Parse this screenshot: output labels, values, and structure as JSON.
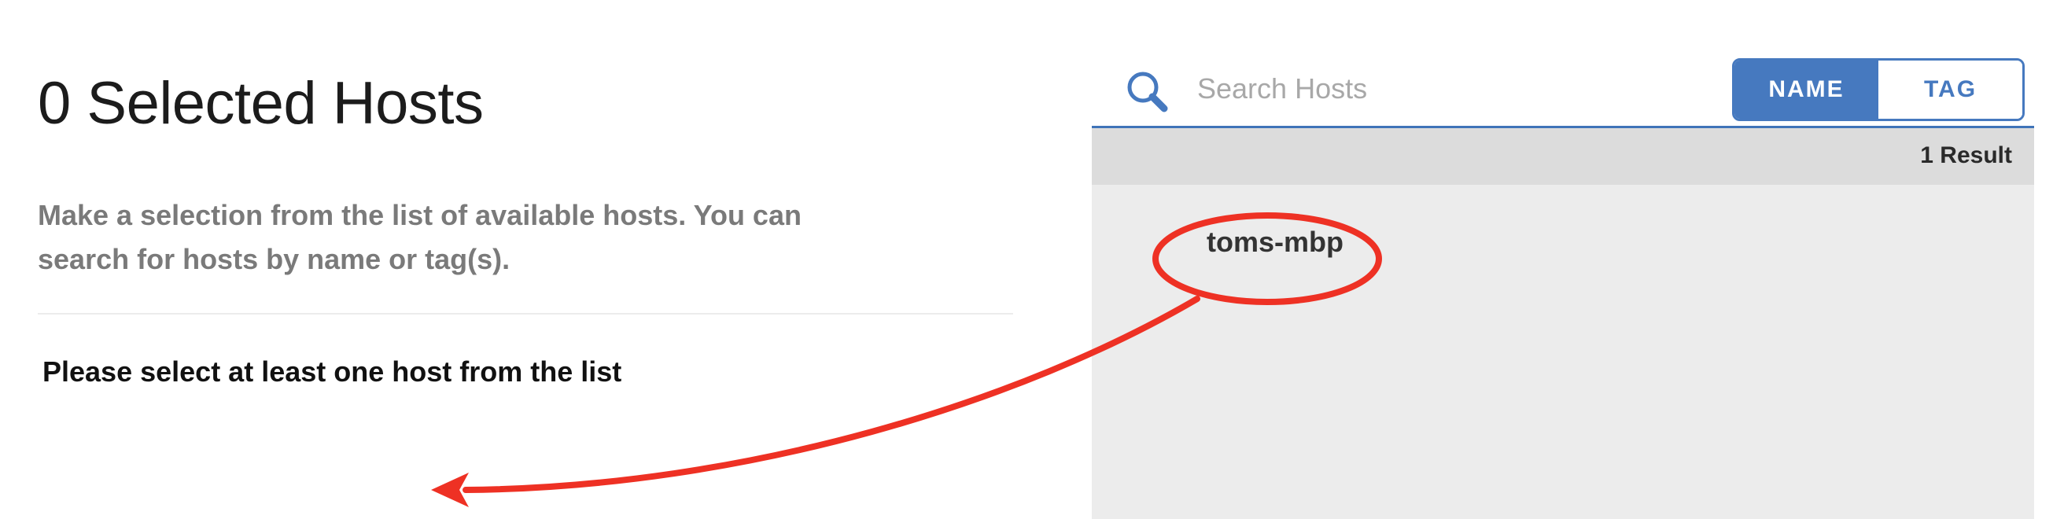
{
  "left_panel": {
    "title": "0 Selected Hosts",
    "description": "Make a selection from the list of available hosts. You can search for hosts by name or tag(s).",
    "validation_message": "Please select at least one host from the list"
  },
  "search": {
    "placeholder": "Search Hosts",
    "value": "",
    "icon": "search-icon"
  },
  "filter_toggle": {
    "options": [
      {
        "label": "NAME",
        "active": true
      },
      {
        "label": "TAG",
        "active": false
      }
    ]
  },
  "results": {
    "count_label": "1 Result",
    "hosts": [
      "toms-mbp"
    ]
  },
  "colors": {
    "accent": "#4679bf",
    "annotation": "#ee3124",
    "results_header_bg": "#dcdcdc",
    "results_list_bg": "#ececec"
  }
}
